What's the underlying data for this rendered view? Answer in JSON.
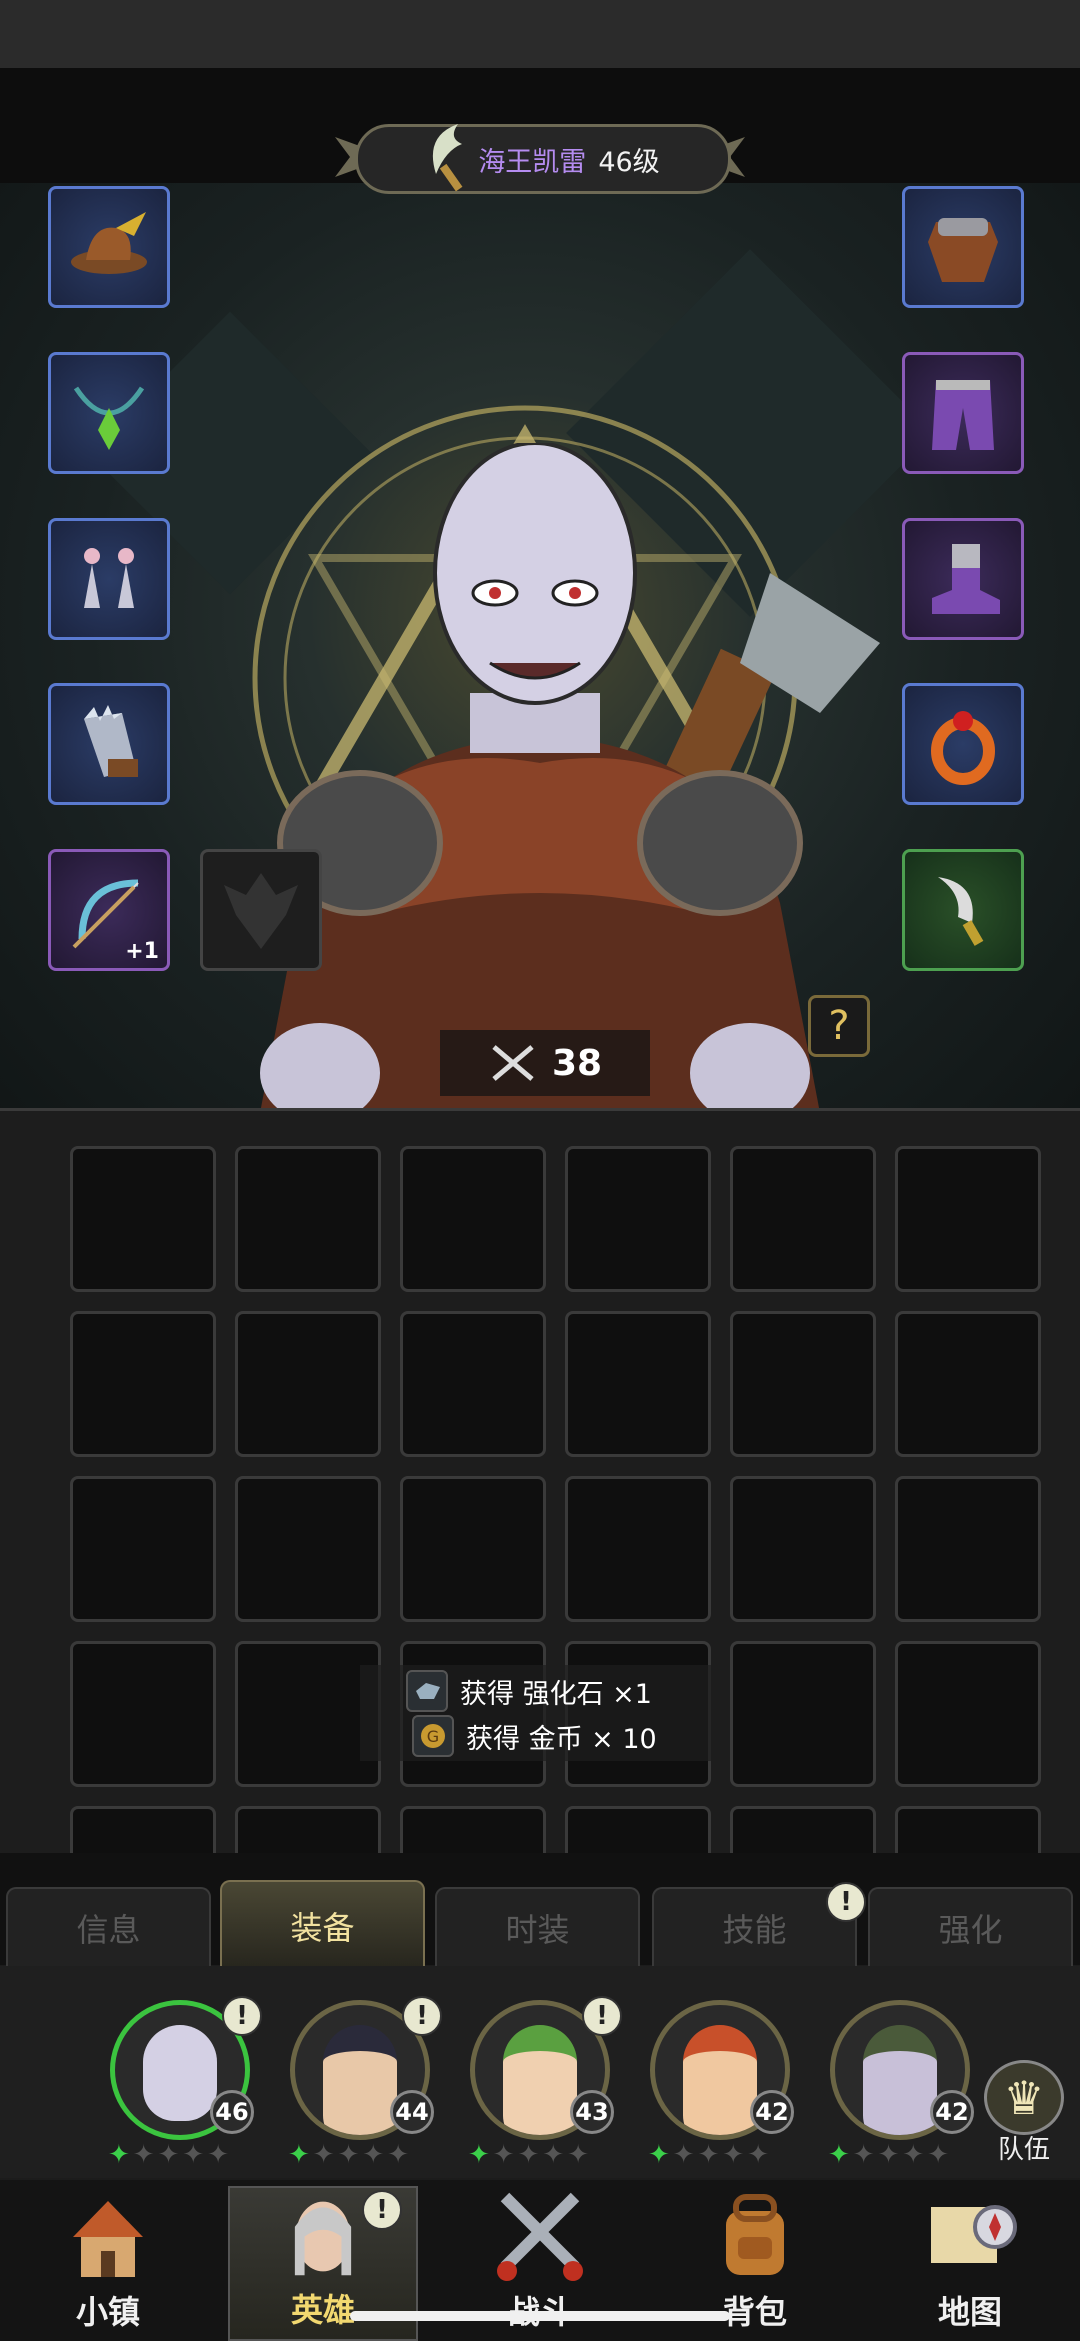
{
  "hero": {
    "name": "海王凯雷",
    "level_text": "46级",
    "power": "38"
  },
  "toast": {
    "line1": "获得 强化石  ×1",
    "line2": "获得 金币  × 10"
  },
  "equipment": {
    "weapon_plus": "+1",
    "help": "?"
  },
  "tabs": [
    "信息",
    "装备",
    "时装",
    "技能",
    "强化"
  ],
  "heroes": [
    {
      "level": "46"
    },
    {
      "level": "44"
    },
    {
      "level": "43"
    },
    {
      "level": "42"
    },
    {
      "level": "42"
    }
  ],
  "team_label": "队伍",
  "nav": [
    "小镇",
    "英雄",
    "战斗",
    "背包",
    "地图"
  ],
  "badge_text": "!"
}
